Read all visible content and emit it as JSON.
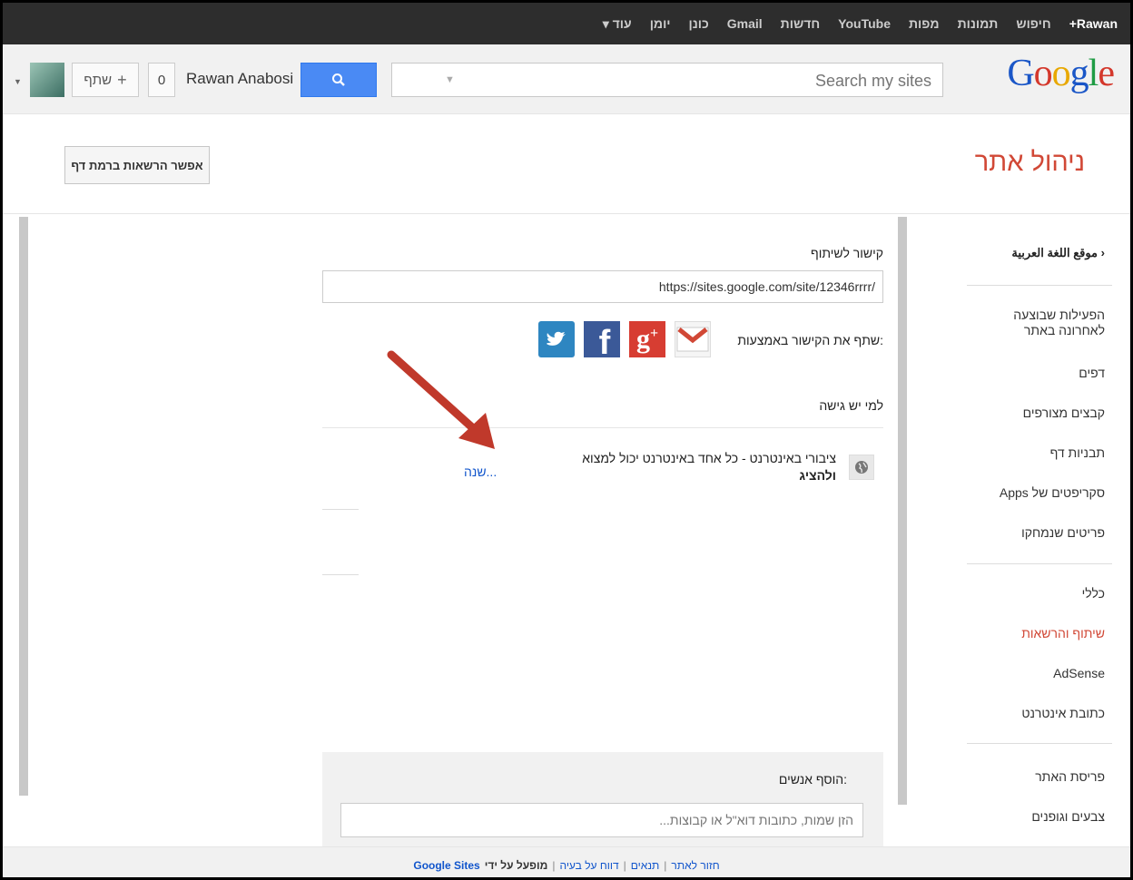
{
  "topbar": {
    "items": [
      "Rawan+",
      "חיפוש",
      "תמונות",
      "מפות",
      "YouTube",
      "חדשות",
      "Gmail",
      "כונן",
      "יומן",
      "עוד ▾"
    ]
  },
  "header": {
    "logo": "Google",
    "search_placeholder": "Search my sites",
    "user_name": "Rawan Anabosi",
    "notif_count": "0",
    "share_label": "שתף"
  },
  "page": {
    "title": "ניהול אתר",
    "page_permissions_button": "אפשר הרשאות ברמת דף"
  },
  "sidebar": {
    "site_name": "موقع اللغة العربية",
    "items": [
      {
        "label": "הפעילות שבוצעה לאחרונה באתר"
      },
      {
        "label": "דפים"
      },
      {
        "label": "קבצים מצורפים"
      },
      {
        "label": "תבניות דף"
      },
      {
        "label": "סקריפטים של Apps"
      },
      {
        "label": "פריטים שנמחקו"
      },
      {
        "label": "כללי"
      },
      {
        "label": "שיתוף והרשאות"
      },
      {
        "label": "AdSense"
      },
      {
        "label": "כתובת אינטרנט"
      },
      {
        "label": "פריסת האתר"
      },
      {
        "label": "צבעים וגופנים"
      }
    ]
  },
  "main": {
    "share_link_label": "קישור לשיתוף",
    "share_url": "https://sites.google.com/site/12346rrrr/",
    "share_via_label": "שתף את הקישור באמצעות:",
    "who_has_access_label": "למי יש גישה",
    "access_text": "ציבורי באינטרנט - כל אחד באינטרנט יכול למצוא",
    "access_text_bold": "ולהציג",
    "change_link": "שנה...",
    "add_people_label": "הוסף אנשים:",
    "add_people_placeholder": "הזן שמות, כתובות דוא\"ל או קבוצות..."
  },
  "footer": {
    "links": [
      "חזור לאתר",
      "תנאים",
      "דווח על בעיה"
    ],
    "powered_by": "מופעל על ידי",
    "brand": "Google Sites"
  },
  "colors": {
    "accent_red": "#d14836",
    "link_blue": "#1155cc",
    "search_button": "#4a8af4"
  }
}
